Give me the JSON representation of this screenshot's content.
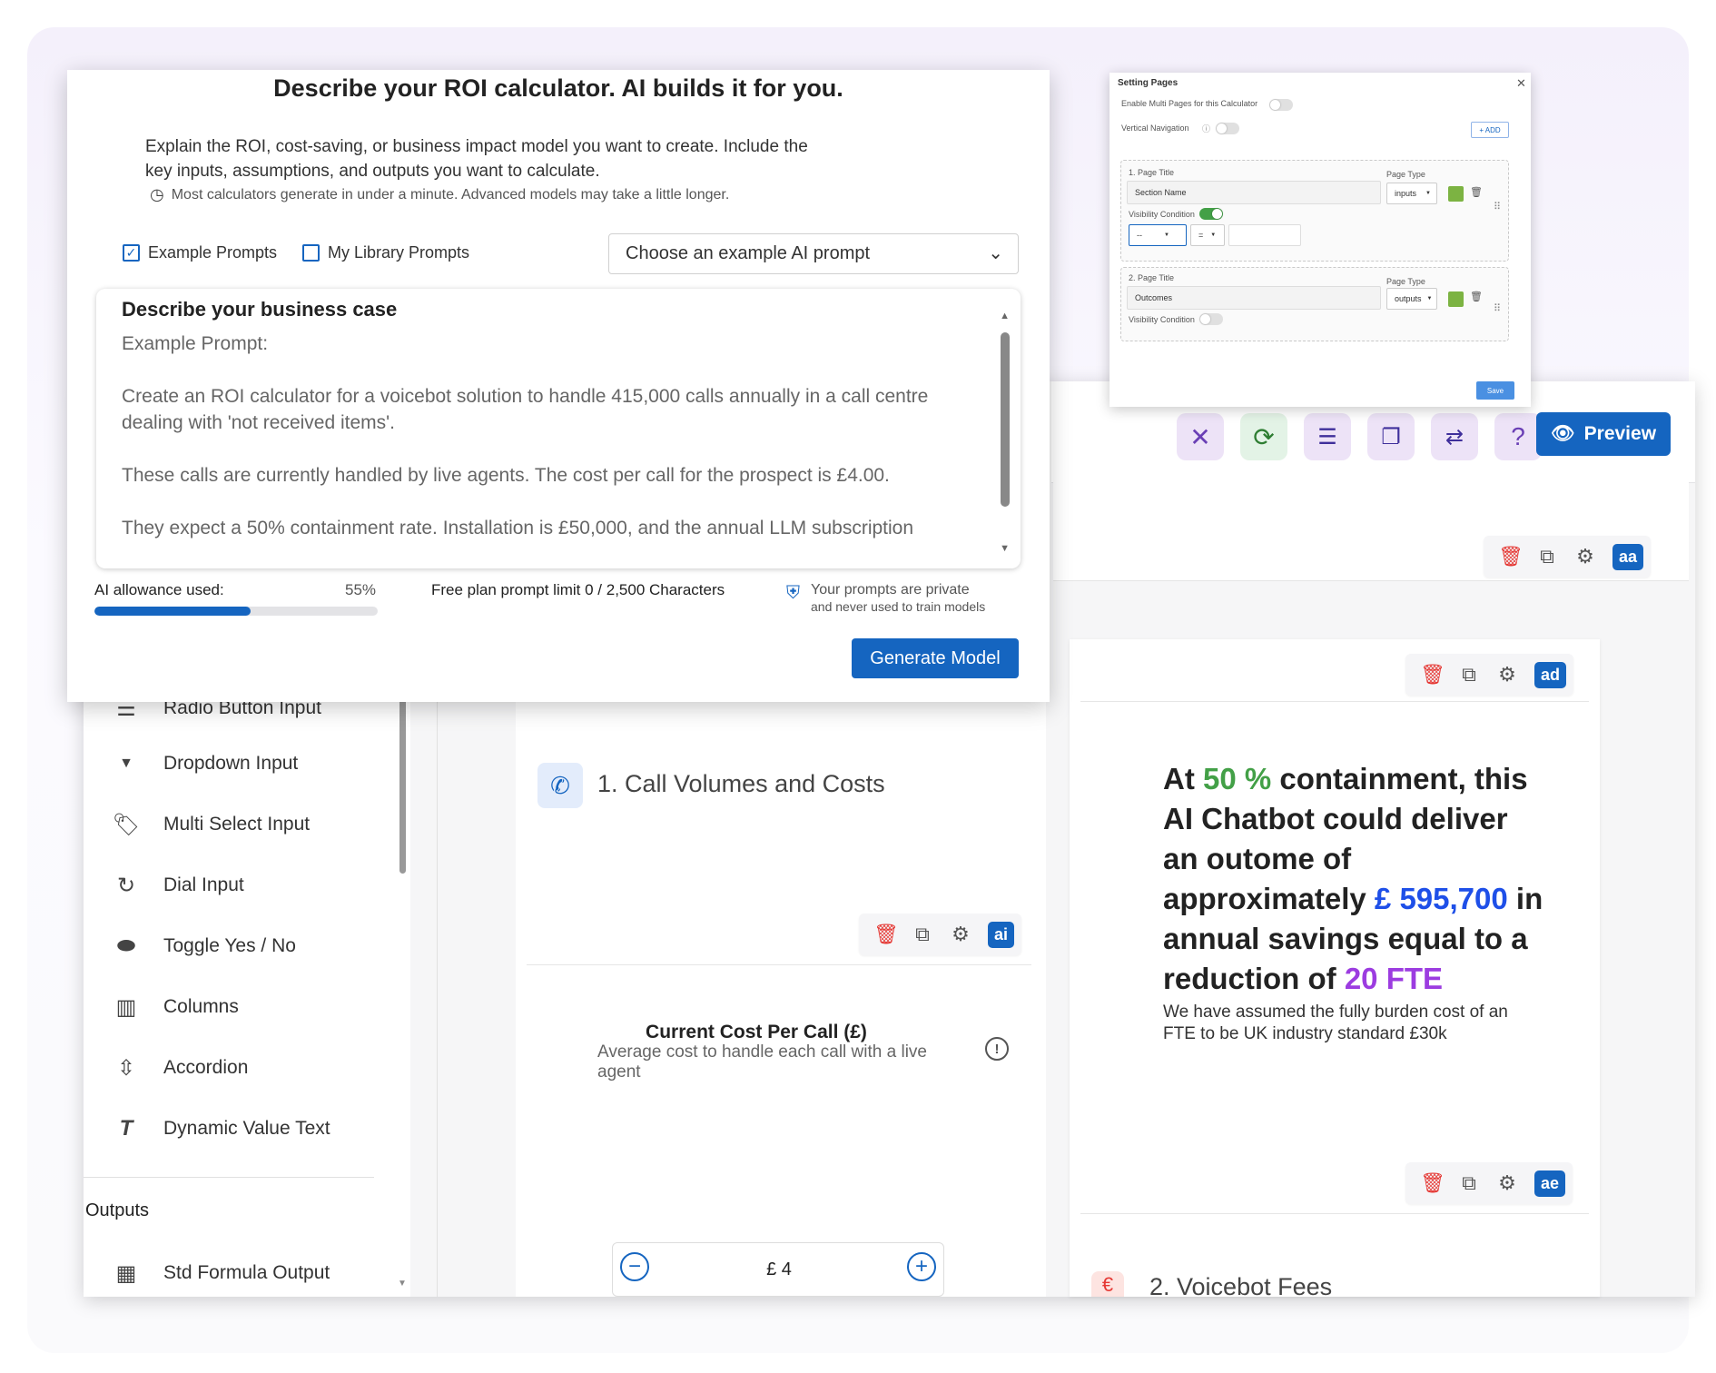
{
  "modal": {
    "title": "Describe your ROI calculator. AI builds it for you.",
    "description": "Explain the ROI, cost-saving, or business impact model you want to create. Include the key inputs, assumptions, and outputs you want to calculate.",
    "hint": "Most calculators generate in under a minute. Advanced models may take a little longer.",
    "example_prompts_label": "Example Prompts",
    "example_prompts_checked": true,
    "library_prompts_label": "My Library Prompts",
    "library_prompts_checked": false,
    "select_placeholder": "Choose an example AI prompt",
    "textarea_label": "Describe your business case",
    "textarea_text": "Example Prompt:\n\nCreate an ROI calculator for a voicebot solution to handle 415,000 calls annually in a call centre dealing with 'not received items'.\n\nThese calls are currently handled by live agents. The cost per call for the prospect is £4.00.\n\nThey expect a 50% containment rate. Installation is £50,000, and the annual LLM subscription",
    "allowance_label": "AI allowance used:",
    "allowance_pct": "55%",
    "allowance_value": 0.55,
    "limit_text": "Free plan prompt limit 0 / 2,500 Characters",
    "privacy_line1": "Your prompts are private",
    "privacy_line2": "and never used to train models",
    "generate_label": "Generate Model"
  },
  "settings": {
    "title": "Setting Pages",
    "multi_pages_label": "Enable Multi Pages for this Calculator",
    "vertical_nav_label": "Vertical Navigation",
    "add_label": "+ ADD",
    "page1": {
      "title_label": "1. Page Title",
      "title_value": "Section Name",
      "type_label": "Page Type",
      "type_value": "inputs",
      "visibility_label": "Visibility Condition",
      "cond_a": "--",
      "cond_b": "="
    },
    "page2": {
      "title_label": "2. Page Title",
      "title_value": "Outcomes",
      "type_label": "Page Type",
      "type_value": "outputs",
      "visibility_label": "Visibility Condition"
    },
    "save_label": "Save"
  },
  "toolbar": {
    "preview_label": "Preview"
  },
  "sidebar": {
    "items": [
      {
        "label": "Radio Button Input",
        "icon": "list-icon"
      },
      {
        "label": "Dropdown Input",
        "icon": "caret-down-icon"
      },
      {
        "label": "Multi Select Input",
        "icon": "tag-icon"
      },
      {
        "label": "Dial Input",
        "icon": "refresh-icon"
      },
      {
        "label": "Toggle Yes / No",
        "icon": "toggle-icon"
      },
      {
        "label": "Columns",
        "icon": "columns-icon"
      },
      {
        "label": "Accordion",
        "icon": "unfold-icon"
      },
      {
        "label": "Dynamic Value Text",
        "icon": "text-format-icon"
      }
    ],
    "outputs_heading": "Outputs",
    "outputs_items": [
      {
        "label": "Std Formula Output",
        "icon": "calculator-icon"
      }
    ]
  },
  "left_column": {
    "section_title": "1. Call Volumes and Costs",
    "badge": "ai",
    "field_title": "Current Cost Per Call (£)",
    "field_desc": "Average cost to handle each call with a live agent",
    "stepper_value": "£ 4",
    "next_section_title": "2. Voicebot Fees"
  },
  "right_column": {
    "badge_top": "aa",
    "badge_ad": "ad",
    "badge_ae": "ae",
    "text_1": "At ",
    "pct": "50 %",
    "text_2": " containment, this AI Chatbot could deliver an outome of approximately ",
    "savings": "£ 595,700",
    "text_3": " in annual savings equal to a reduction of ",
    "fte": "20 FTE",
    "note": "We have assumed the fully burden cost of an FTE to be UK industry standard £30k"
  },
  "colors": {
    "accent": "#1565c0",
    "green": "#43a047",
    "blue": "#1e4fe8",
    "purple": "#9c3ce0",
    "delete": "#e53935"
  }
}
